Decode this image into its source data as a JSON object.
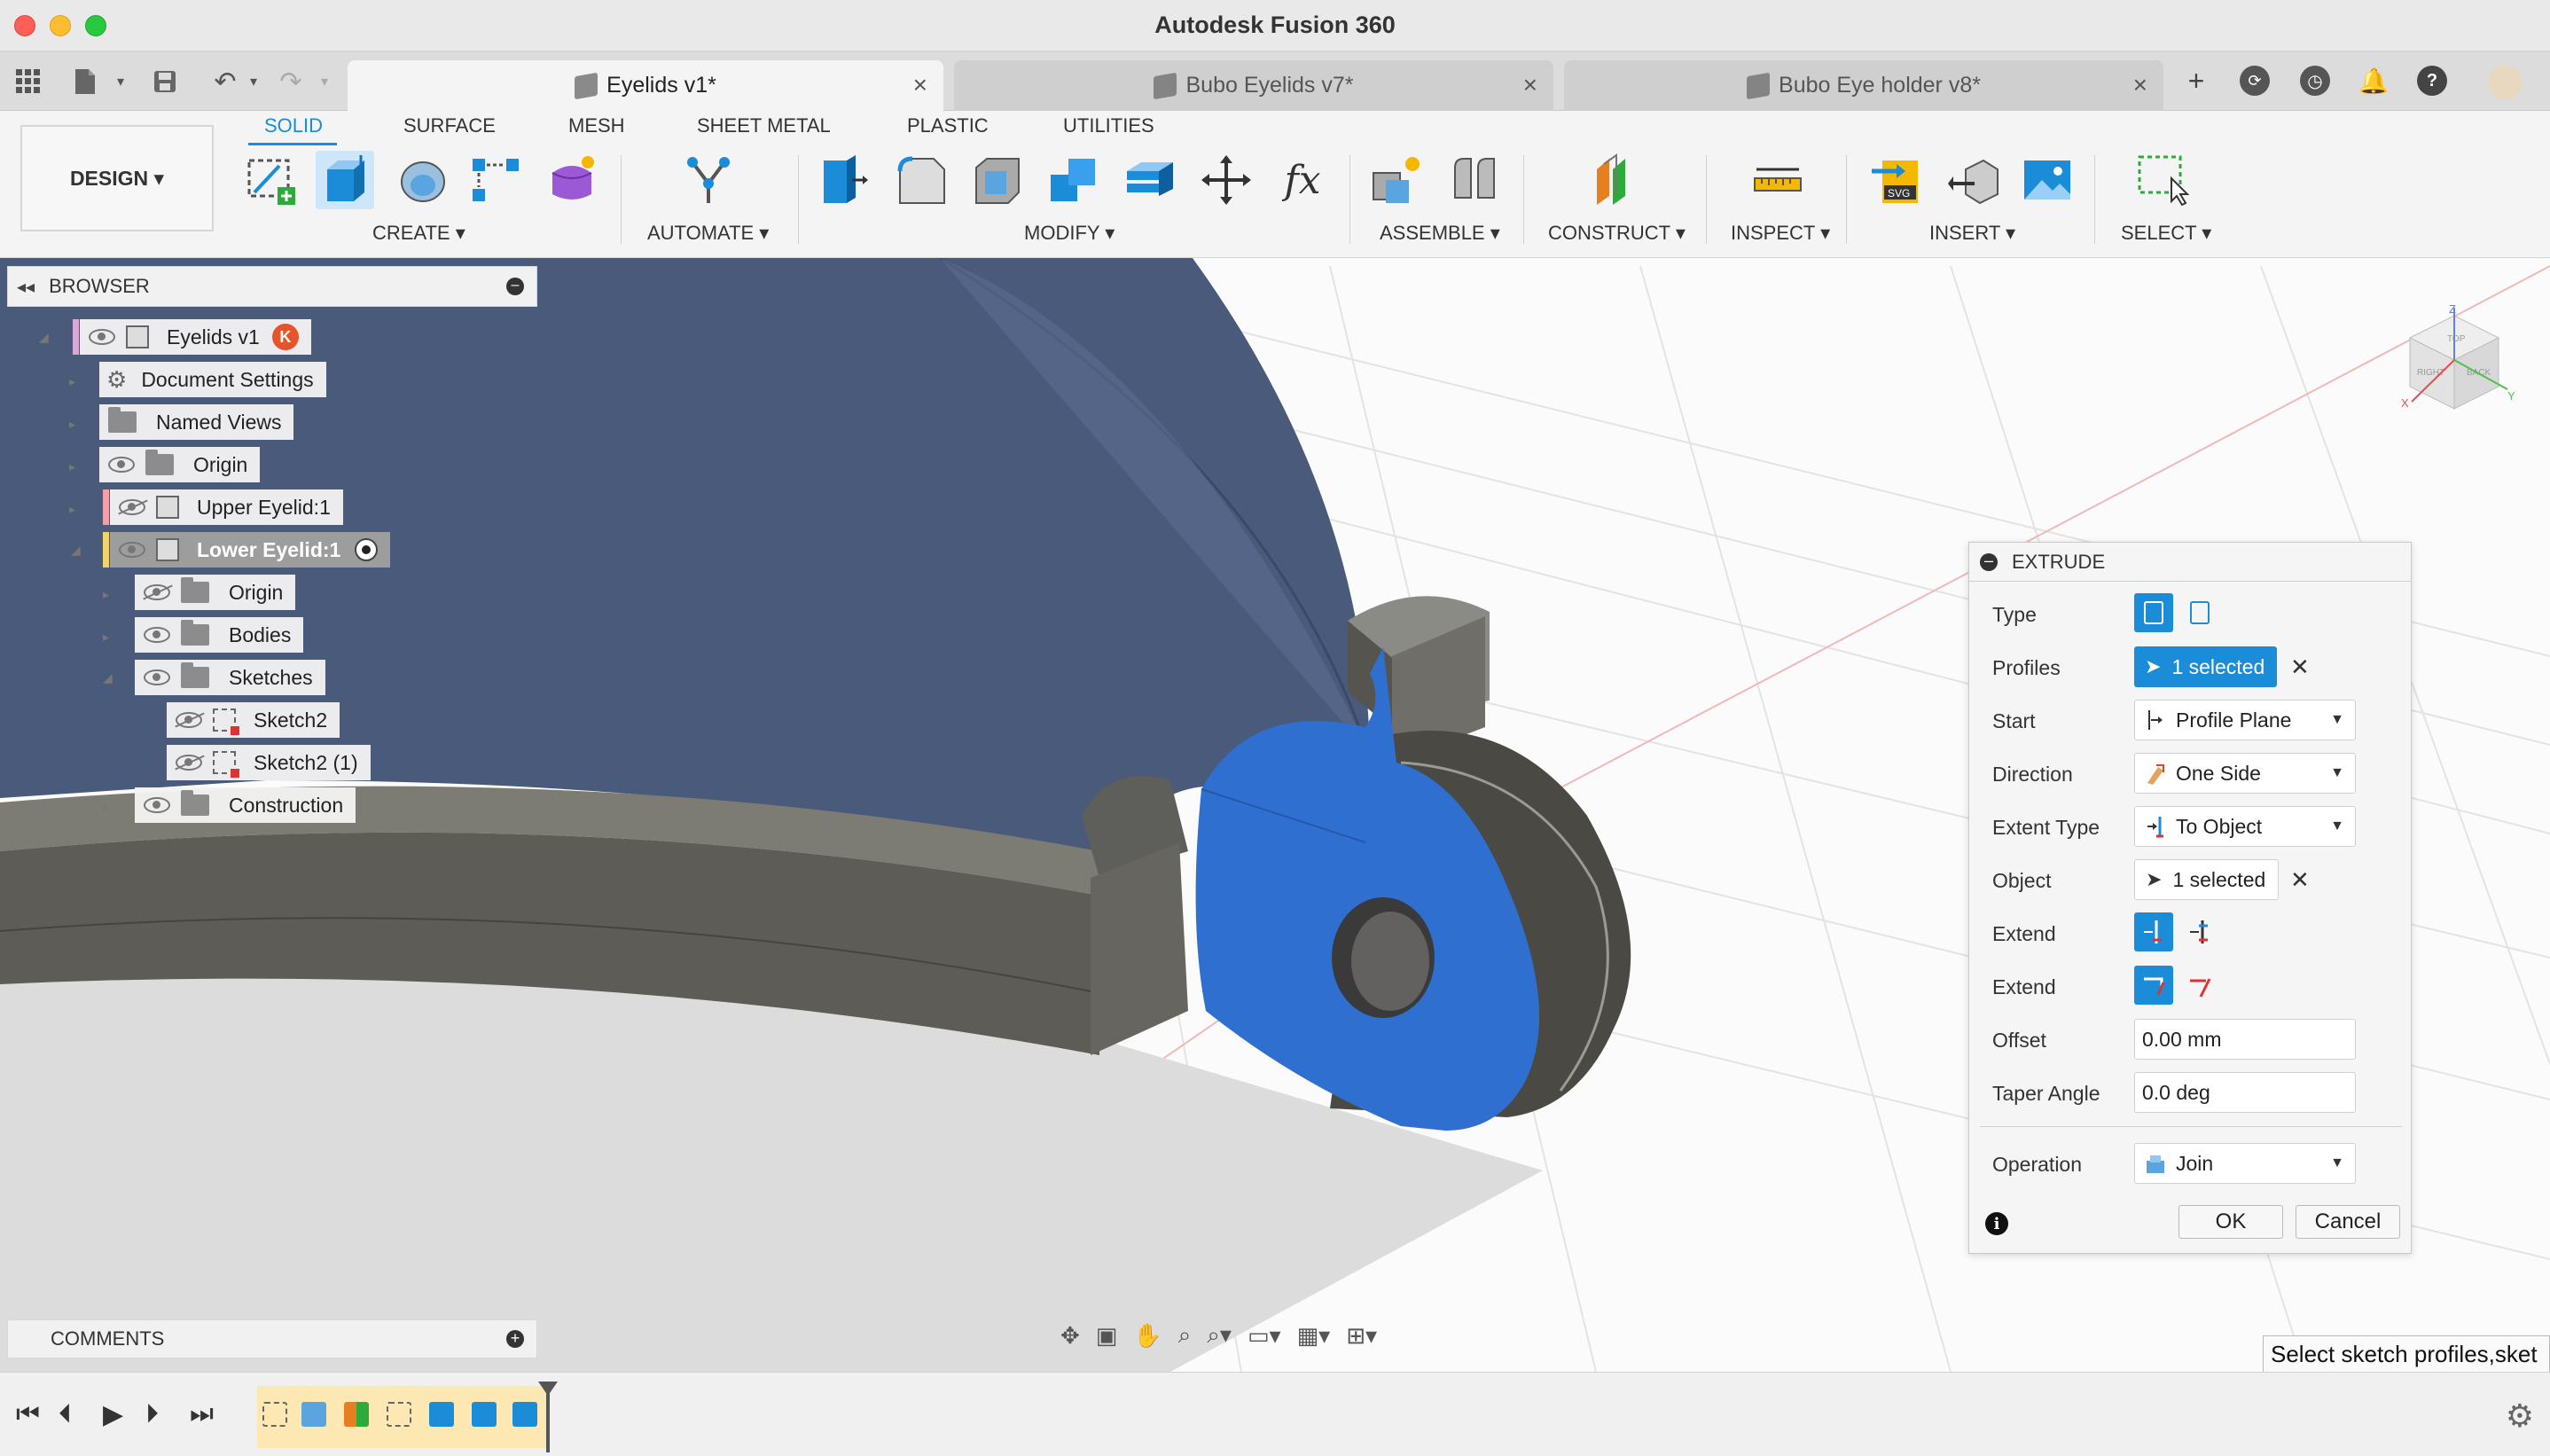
{
  "app": {
    "title": "Autodesk Fusion 360"
  },
  "document_tabs": [
    {
      "label": "Eyelids v1*",
      "active": true
    },
    {
      "label": "Bubo Eyelids v7*",
      "active": false
    },
    {
      "label": "Bubo Eye holder v8*",
      "active": false
    }
  ],
  "ribbon": {
    "workspace": "DESIGN ▾",
    "tabs": [
      "SOLID",
      "SURFACE",
      "MESH",
      "SHEET METAL",
      "PLASTIC",
      "UTILITIES"
    ],
    "active_tab": "SOLID",
    "groups": [
      "CREATE ▾",
      "AUTOMATE ▾",
      "MODIFY ▾",
      "ASSEMBLE ▾",
      "CONSTRUCT ▾",
      "INSPECT ▾",
      "INSERT ▾",
      "SELECT ▾"
    ],
    "accent_color": "#1a8cd8"
  },
  "browser": {
    "title": "BROWSER",
    "nodes": [
      {
        "label": "Eyelids v1",
        "badge": "K"
      },
      {
        "label": "Document Settings"
      },
      {
        "label": "Named Views"
      },
      {
        "label": "Origin"
      },
      {
        "label": "Upper Eyelid:1"
      },
      {
        "label": "Lower Eyelid:1"
      },
      {
        "label": "Origin"
      },
      {
        "label": "Bodies"
      },
      {
        "label": "Sketches"
      },
      {
        "label": "Sketch2"
      },
      {
        "label": "Sketch2 (1)"
      },
      {
        "label": "Construction"
      }
    ]
  },
  "comments": {
    "title": "COMMENTS"
  },
  "extrude": {
    "title": "EXTRUDE",
    "rows": {
      "type": {
        "label": "Type"
      },
      "profiles": {
        "label": "Profiles",
        "value": "1 selected"
      },
      "start": {
        "label": "Start",
        "value": "Profile Plane"
      },
      "direction": {
        "label": "Direction",
        "value": "One Side"
      },
      "extent_type": {
        "label": "Extent Type",
        "value": "To Object"
      },
      "object": {
        "label": "Object",
        "value": "1 selected"
      },
      "extend1": {
        "label": "Extend"
      },
      "extend2": {
        "label": "Extend"
      },
      "offset": {
        "label": "Offset",
        "value": "0.00 mm"
      },
      "taper": {
        "label": "Taper Angle",
        "value": "0.0 deg"
      },
      "operation": {
        "label": "Operation",
        "value": "Join"
      }
    },
    "ok_label": "OK",
    "cancel_label": "Cancel"
  },
  "tooltip": {
    "text": "Select sketch profiles,sket"
  },
  "viewcube": {
    "faces": [
      "TOP",
      "RIGHT",
      "BACK"
    ],
    "axes": [
      "X",
      "Y",
      "Z"
    ]
  },
  "icons": {
    "apps": "apps-grid-icon",
    "file": "file-icon",
    "save": "save-icon",
    "undo": "undo-icon",
    "redo": "redo-icon",
    "new_tab": "plus-icon",
    "job_status": "job-status-icon",
    "history": "clock-icon",
    "notifications": "bell-icon",
    "help": "help-icon",
    "settings": "gear-icon"
  },
  "colors": {
    "face_selected": "#2f6fcf",
    "body_dark": "#4a4e56",
    "body_mid": "#6b6a63",
    "body_light": "#8e8d86",
    "dome": "#4a5a7a"
  }
}
